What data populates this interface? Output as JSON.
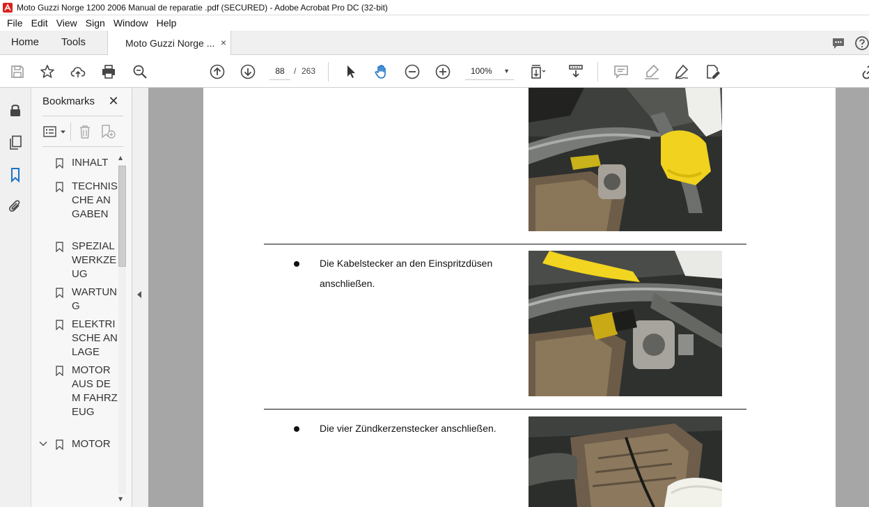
{
  "window": {
    "title": "Moto Guzzi Norge 1200 2006 Manual de reparatie  .pdf (SECURED) - Adobe Acrobat Pro DC (32-bit)"
  },
  "menu": [
    "File",
    "Edit",
    "View",
    "Sign",
    "Window",
    "Help"
  ],
  "tabs": {
    "home": "Home",
    "tools": "Tools",
    "document": "Moto Guzzi Norge ...",
    "close_glyph": "×"
  },
  "toolbar": {
    "current_page": "88",
    "page_separator": "/",
    "total_pages": "263",
    "zoom": "100%"
  },
  "bookmarks": {
    "title": "Bookmarks",
    "close_glyph": "✕",
    "items": [
      {
        "label": "INHALT",
        "expandable": false
      },
      {
        "label": "TECHNISCHE ANGABEN",
        "expandable": false
      },
      {
        "label": "SPEZIALWERKZEUG",
        "expandable": false
      },
      {
        "label": "WARTUNG",
        "expandable": false
      },
      {
        "label": "ELEKTRISCHE ANLAGE",
        "expandable": false
      },
      {
        "label": "MOTOR AUS DEM FAHRZEUG",
        "expandable": false
      },
      {
        "label": "MOTOR",
        "expandable": true
      }
    ]
  },
  "document": {
    "steps": [
      {
        "text": "Die Kabelstecker an den Einspritzdüsen anschließen."
      },
      {
        "text": "Die vier Zündkerzenstecker anschließen."
      }
    ]
  },
  "colors": {
    "accent": "#1a73c9",
    "doc_background": "#a6a6a6",
    "glove_yellow": "#f2d21c",
    "adobe_red": "#d8221c"
  }
}
